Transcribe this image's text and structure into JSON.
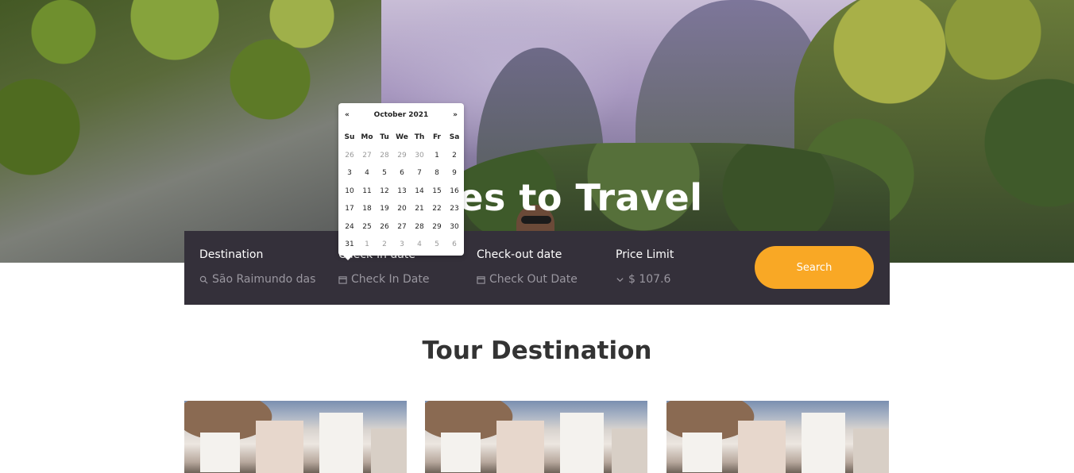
{
  "hero": {
    "title": "Places to Travel"
  },
  "search": {
    "destination_label": "Destination",
    "destination_value": "São Raimundo das",
    "checkin_label": "Check-in date",
    "checkin_placeholder": "Check In Date",
    "checkout_label": "Check-out date",
    "checkout_placeholder": "Check Out Date",
    "price_label": "Price Limit",
    "price_value": "$ 107.6",
    "button_label": "Search"
  },
  "datepicker": {
    "prev": "«",
    "next": "»",
    "title": "October 2021",
    "days_of_week": [
      "Su",
      "Mo",
      "Tu",
      "We",
      "Th",
      "Fr",
      "Sa"
    ],
    "weeks": [
      [
        {
          "d": "26",
          "old": true
        },
        {
          "d": "27",
          "old": true
        },
        {
          "d": "28",
          "old": true
        },
        {
          "d": "29",
          "old": true
        },
        {
          "d": "30",
          "old": true
        },
        {
          "d": "1"
        },
        {
          "d": "2"
        }
      ],
      [
        {
          "d": "3"
        },
        {
          "d": "4"
        },
        {
          "d": "5"
        },
        {
          "d": "6"
        },
        {
          "d": "7"
        },
        {
          "d": "8"
        },
        {
          "d": "9"
        }
      ],
      [
        {
          "d": "10"
        },
        {
          "d": "11"
        },
        {
          "d": "12"
        },
        {
          "d": "13"
        },
        {
          "d": "14"
        },
        {
          "d": "15"
        },
        {
          "d": "16"
        }
      ],
      [
        {
          "d": "17"
        },
        {
          "d": "18"
        },
        {
          "d": "19"
        },
        {
          "d": "20"
        },
        {
          "d": "21"
        },
        {
          "d": "22"
        },
        {
          "d": "23"
        }
      ],
      [
        {
          "d": "24"
        },
        {
          "d": "25"
        },
        {
          "d": "26"
        },
        {
          "d": "27"
        },
        {
          "d": "28"
        },
        {
          "d": "29"
        },
        {
          "d": "30"
        }
      ],
      [
        {
          "d": "31"
        },
        {
          "d": "1",
          "old": true
        },
        {
          "d": "2",
          "old": true
        },
        {
          "d": "3",
          "old": true
        },
        {
          "d": "4",
          "old": true
        },
        {
          "d": "5",
          "old": true
        },
        {
          "d": "6",
          "old": true
        }
      ]
    ]
  },
  "section": {
    "title": "Tour Destination"
  },
  "colors": {
    "search_bar_bg": "#34303a",
    "accent": "#f9a825",
    "heading": "#333333"
  },
  "icons": {
    "destination": "search-icon",
    "checkin": "calendar-icon",
    "checkout": "calendar-icon",
    "price": "chevron-down-icon"
  }
}
